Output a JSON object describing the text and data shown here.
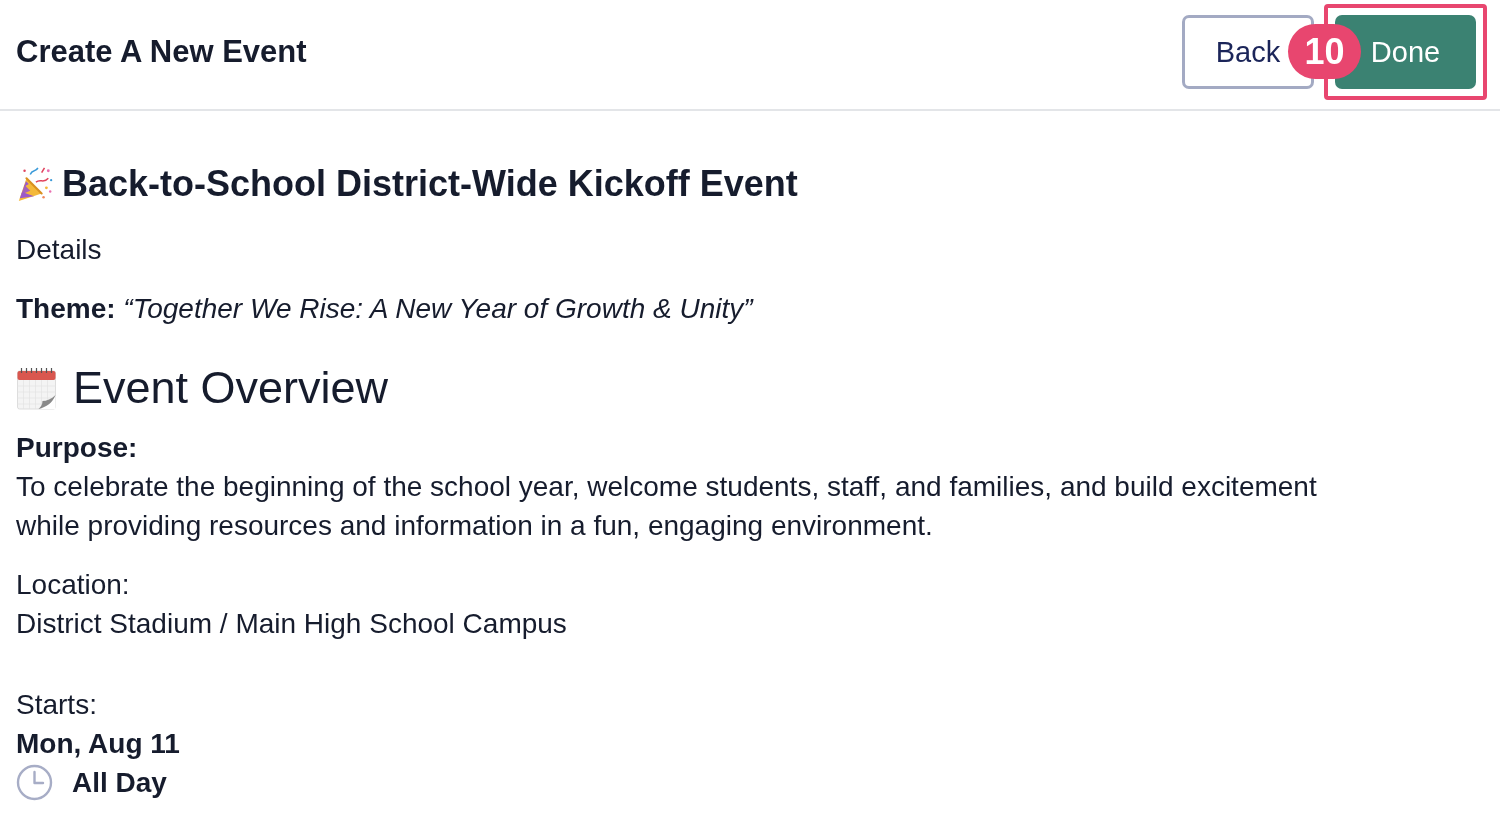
{
  "header": {
    "title": "Create A New Event",
    "buttons": [
      {
        "label": "Back",
        "kind": "secondary",
        "highlighted": false
      },
      {
        "label": "Done",
        "kind": "primary",
        "highlighted": true
      }
    ],
    "step_marker": {
      "label": "10"
    }
  },
  "event": {
    "title": "Back-to-School District-Wide Kickoff Event",
    "subtitle": "Details",
    "theme": "**Theme:** *“Together We Rise: A New Year of Growth & Unity”*",
    "overview": {
      "heading": "Event Overview",
      "purpose": {
        "label": "Purpose:",
        "text": "To celebrate the beginning of the school year, welcome students, staff, and families, and build excitement while providing resources and information in a fun, engaging environment."
      },
      "location": {
        "label": "Location:",
        "text": "District Stadium / Main High School Campus"
      },
      "starts": {
        "label": "Starts:",
        "date": "Mon, Aug 11",
        "time": "All Day"
      }
    }
  }
}
